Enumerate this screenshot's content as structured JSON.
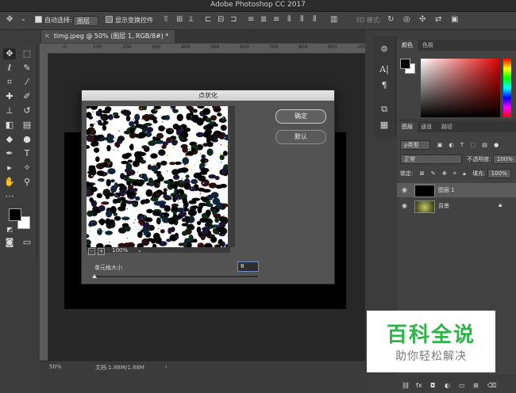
{
  "app": {
    "title": "Adobe Photoshop CC 2017"
  },
  "options_bar": {
    "auto_select_label": "自动选择:",
    "auto_select_value": "图层",
    "show_transform_label": "显示变换控件",
    "mode_3d_label": "3D 模式:"
  },
  "document": {
    "tab_title": "timg.jpeg @ 50% (图层 1, RGB/8#) *"
  },
  "ruler": {
    "ticks": [
      "0",
      "100",
      "200",
      "300",
      "400",
      "500",
      "600",
      "700",
      "800",
      "900",
      "1000",
      "1100"
    ]
  },
  "status": {
    "zoom": "50%",
    "doc_info": "文档:1.88M/1.88M"
  },
  "panels": {
    "color_tabs": [
      "颜色",
      "色板"
    ],
    "layer_tabs": [
      "图层",
      "通道",
      "路径"
    ],
    "kind_filter": "ρ类型",
    "blend_mode": "正常",
    "opacity_label": "不透明度:",
    "opacity_value": "100%",
    "lock_label": "锁定:",
    "fill_label": "填充:",
    "fill_value": "100%",
    "layers": [
      {
        "name": "图层 1",
        "selected": true
      },
      {
        "name": "背景",
        "selected": false
      }
    ]
  },
  "dialog": {
    "title": "点状化",
    "ok_label": "确定",
    "default_label": "默认",
    "preview_zoom": "100%",
    "cell_size_label": "单元格大小",
    "cell_size_value": "8",
    "cell_size_fraction": 0.0
  },
  "watermark": {
    "line1": "百科全说",
    "line2": "助你轻松解决"
  },
  "colors": {
    "accent_green": "#2fb34a",
    "input_focus": "#6c8cc7"
  }
}
